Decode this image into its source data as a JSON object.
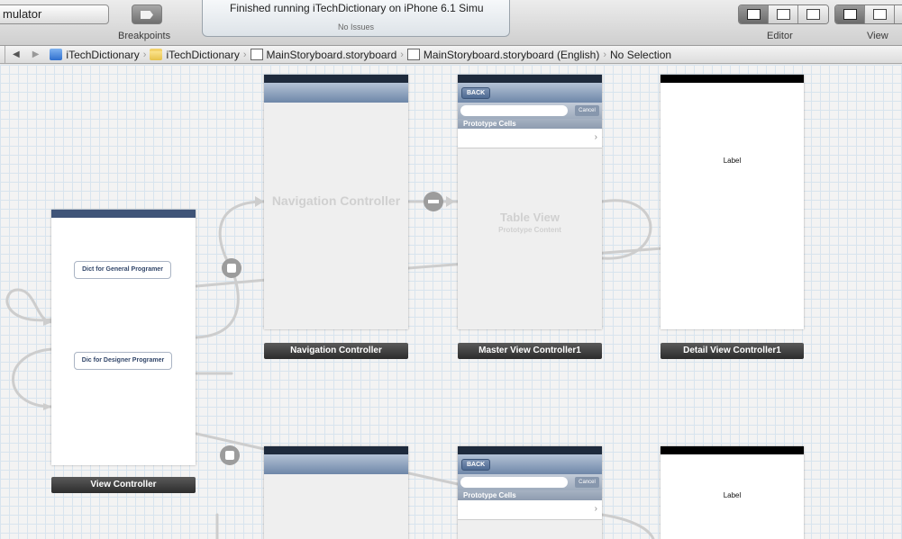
{
  "toolbar": {
    "scheme": "mulator",
    "breakpoints_label": "Breakpoints",
    "activity_message": "Finished running iTechDictionary on iPhone 6.1 Simu",
    "activity_status": "No Issues",
    "editor_label": "Editor",
    "view_label": "View"
  },
  "jumpbar": {
    "crumbs": [
      "iTechDictionary",
      "iTechDictionary",
      "MainStoryboard.storyboard",
      "MainStoryboard.storyboard (English)",
      "No Selection"
    ]
  },
  "storyboard": {
    "nav_ghost": "Navigation Controller",
    "table_ghost": "Table View",
    "table_ghost_sub": "Prototype Content",
    "back_label": "BACK",
    "cancel_label": "Cancel",
    "section_label": "Prototype Cells",
    "detail_label": "Label",
    "vc_button_1": "Dict for General Programer",
    "vc_button_2": "Dic for Designer Programer",
    "captions": {
      "nav": "Navigation Controller",
      "master": "Master View Controller1",
      "detail": "Detail View Controller1",
      "vc": "View Controller"
    }
  },
  "colors": {
    "canvas": "#f3f3f3",
    "navbar": "#6e87a8",
    "caption": "#2c2c2c"
  }
}
